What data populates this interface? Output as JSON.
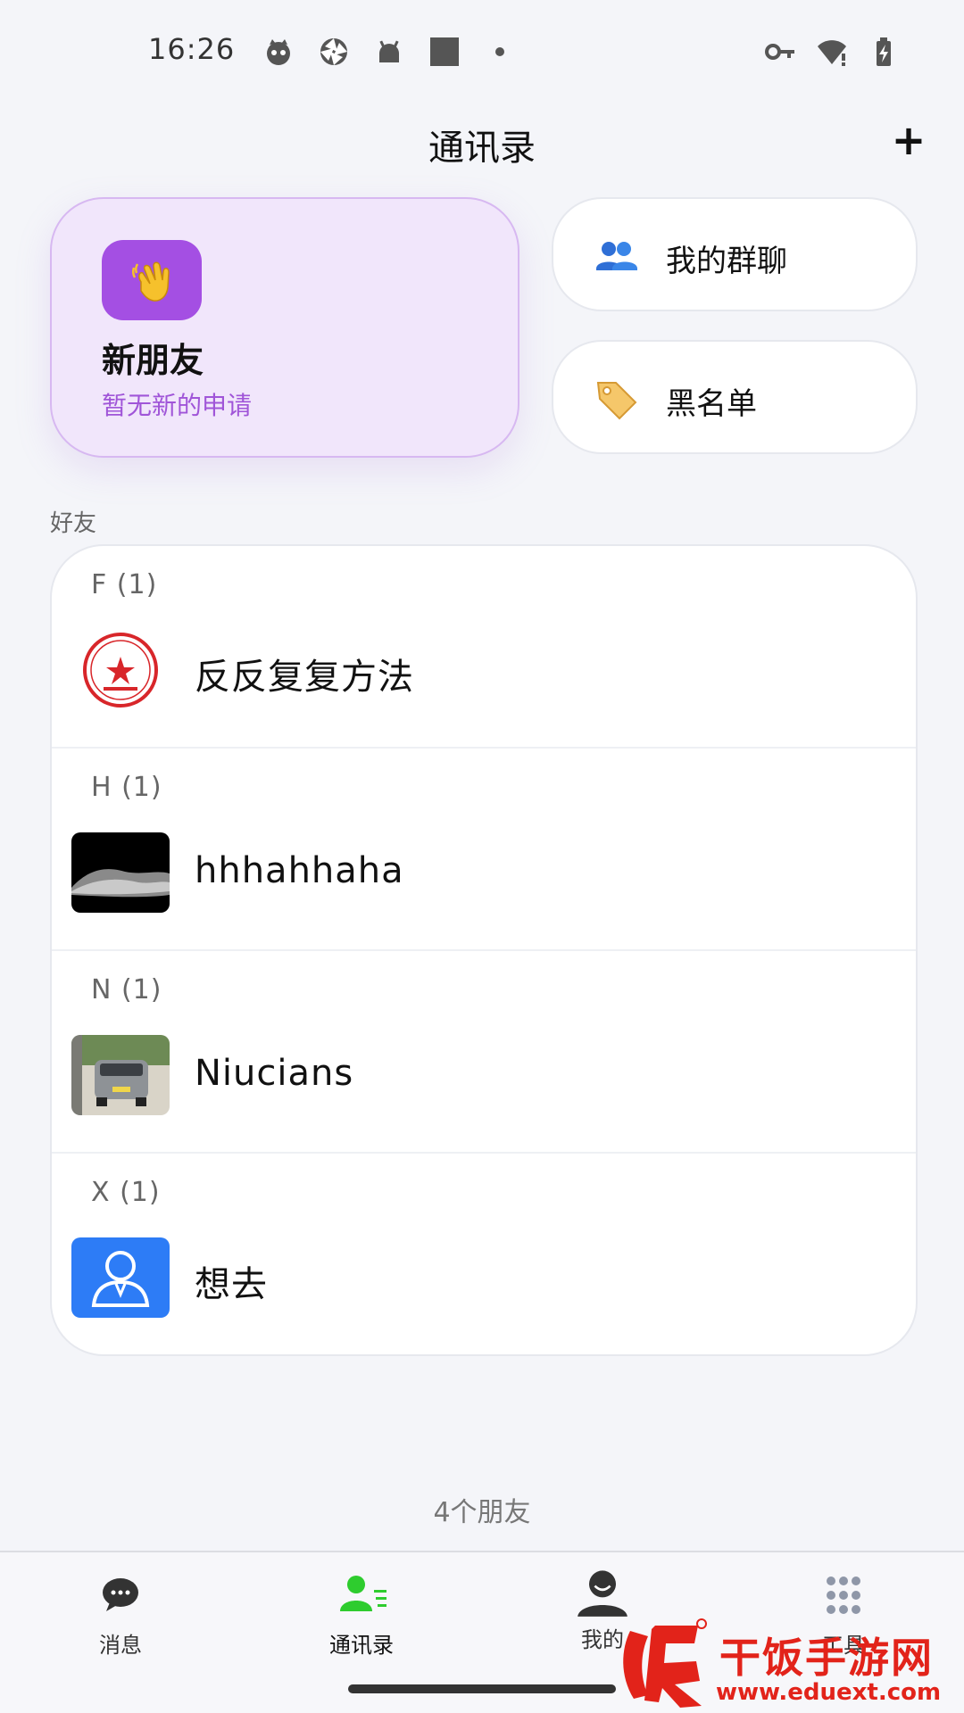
{
  "status_bar": {
    "time": "16:26",
    "left_icons": [
      "cat-face-icon",
      "aperture-icon",
      "android-icon",
      "square-icon",
      "dot-icon"
    ],
    "right_icons": [
      "vpn-key-icon",
      "wifi-alert-icon",
      "battery-charging-icon"
    ]
  },
  "header": {
    "title": "通讯录",
    "add_label": "+"
  },
  "new_friends": {
    "title": "新朋友",
    "subtitle": "暂无新的申请",
    "icon": "waving-hand-icon"
  },
  "groups": {
    "label": "我的群聊",
    "icon": "people-icon"
  },
  "blacklist": {
    "label": "黑名单",
    "icon": "tag-icon"
  },
  "section_label": "好友",
  "friend_groups": [
    {
      "header": "F (1)",
      "name": "反反复复方法",
      "avatar": "red-seal-avatar"
    },
    {
      "header": "H (1)",
      "name": "hhhahhaha",
      "avatar": "moon-surface-avatar"
    },
    {
      "header": "N (1)",
      "name": "Niucians",
      "avatar": "car-photo-avatar"
    },
    {
      "header": "X (1)",
      "name": "想去",
      "avatar": "default-user-avatar"
    }
  ],
  "friend_count": "4个朋友",
  "bottom_nav": {
    "messages": "消息",
    "contacts": "通讯录",
    "mine": "我的",
    "tools": "工具"
  },
  "watermark": {
    "text": "干饭手游网",
    "url": "www.eduext.com"
  },
  "colors": {
    "accent_purple": "#a44fe3",
    "active_green": "#2ecc2e",
    "watermark_red": "#e2231a"
  }
}
